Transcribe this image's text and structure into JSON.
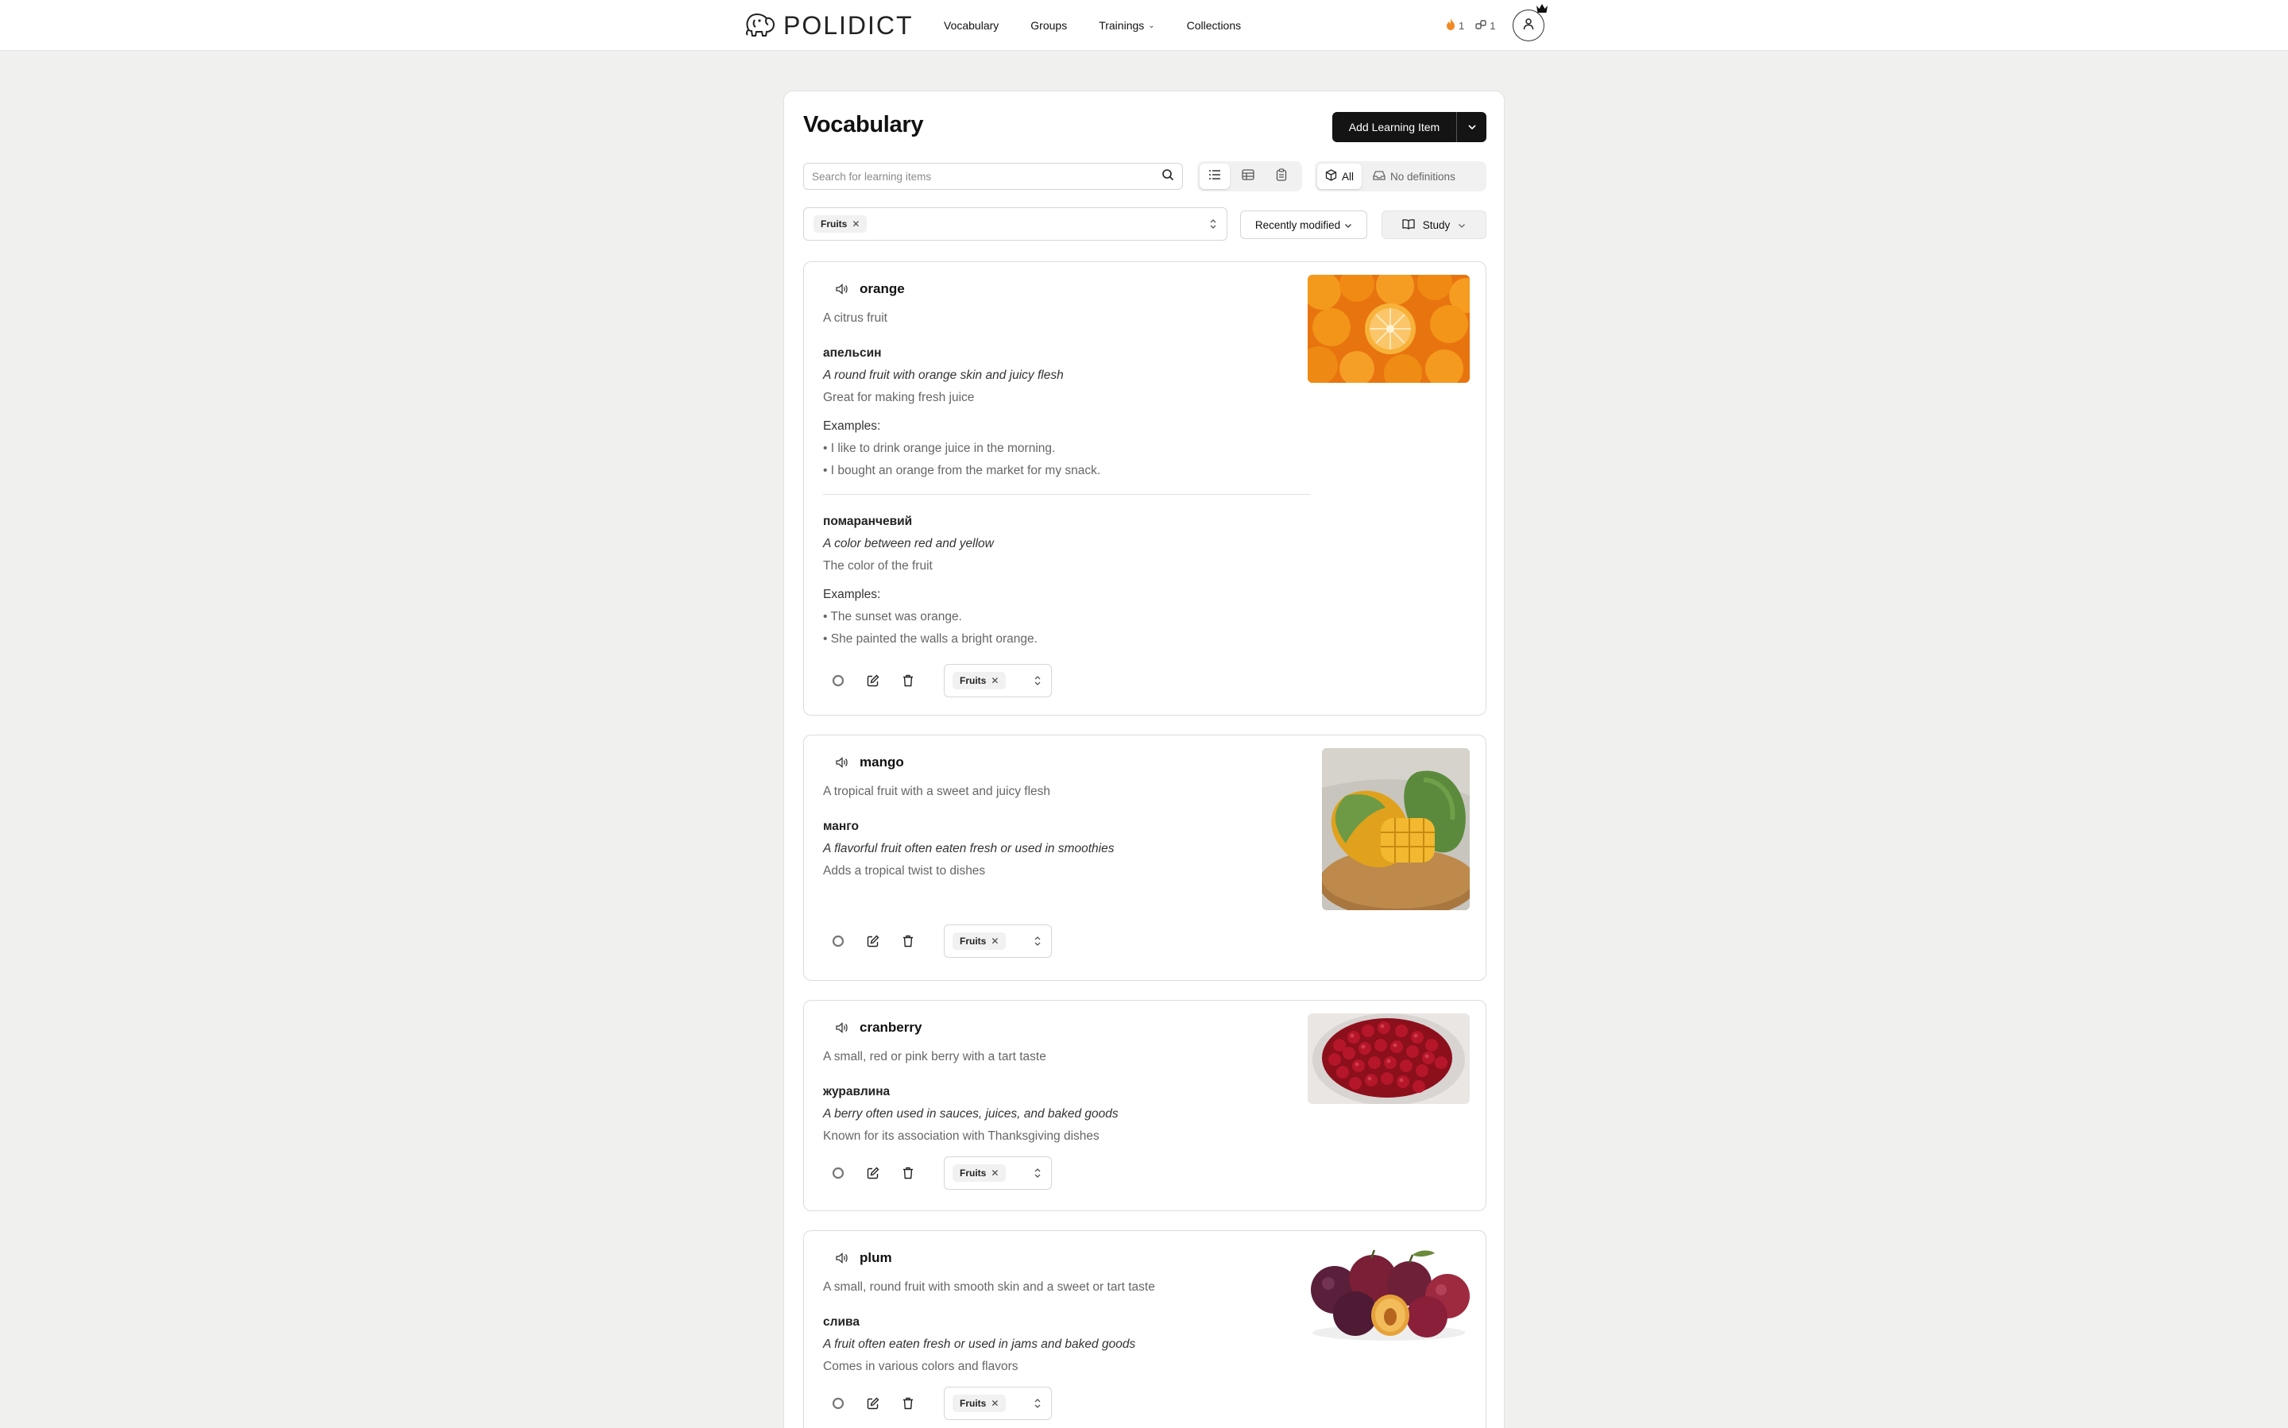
{
  "app": {
    "name": "POLIDICT"
  },
  "nav": {
    "links": [
      {
        "label": "Vocabulary"
      },
      {
        "label": "Groups"
      },
      {
        "label": "Trainings"
      },
      {
        "label": "Collections"
      }
    ],
    "streak_count": "1",
    "links_count": "1"
  },
  "page": {
    "title": "Vocabulary",
    "add_button": "Add Learning Item",
    "search_placeholder": "Search for learning items",
    "filter_all": "All",
    "filter_no_definitions": "No definitions",
    "group_chip": "Fruits",
    "sort_label": "Recently modified",
    "study_label": "Study"
  },
  "cards": [
    {
      "term": "orange",
      "description": "A citrus fruit",
      "image": "oranges-photo",
      "translations": [
        {
          "word": "апельсин",
          "definition": "A round fruit with orange skin and juicy flesh",
          "note": "Great for making fresh juice",
          "examples_heading": "Examples:",
          "examples": [
            "• I like to drink orange juice in the morning.",
            "• I bought an orange from the market for my snack."
          ]
        },
        {
          "word": "помаранчевий",
          "definition": "A color between red and yellow",
          "note": "The color of the fruit",
          "examples_heading": "Examples:",
          "examples": [
            "• The sunset was orange.",
            "• She painted the walls a bright orange."
          ]
        }
      ],
      "group": "Fruits"
    },
    {
      "term": "mango",
      "description": "A tropical fruit with a sweet and juicy flesh",
      "image": "mango-photo",
      "translations": [
        {
          "word": "манго",
          "definition": "A flavorful fruit often eaten fresh or used in smoothies",
          "note": "Adds a tropical twist to dishes"
        }
      ],
      "group": "Fruits"
    },
    {
      "term": "cranberry",
      "description": "A small, red or pink berry with a tart taste",
      "image": "cranberries-photo",
      "translations": [
        {
          "word": "журавлина",
          "definition": "A berry often used in sauces, juices, and baked goods",
          "note": "Known for its association with Thanksgiving dishes"
        }
      ],
      "group": "Fruits"
    },
    {
      "term": "plum",
      "description": "A small, round fruit with smooth skin and a sweet or tart taste",
      "image": "plums-photo",
      "translations": [
        {
          "word": "слива",
          "definition": "A fruit often eaten fresh or used in jams and baked goods",
          "note": "Comes in various colors and flavors"
        }
      ],
      "group": "Fruits"
    }
  ],
  "colors": {
    "primary": "#141414",
    "background": "#f0f0ef",
    "accent_flame": "#f08a24"
  }
}
